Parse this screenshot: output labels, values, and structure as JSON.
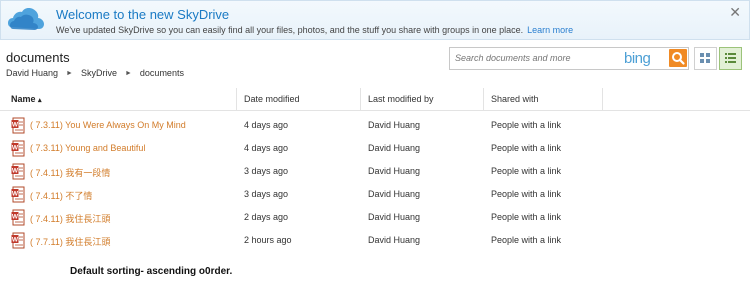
{
  "banner": {
    "title": "Welcome to the new SkyDrive",
    "message": "We've updated SkyDrive so you can easily find all your files, photos, and the stuff you share with groups in one place.",
    "learn_more": "Learn more",
    "close": "✕"
  },
  "page": {
    "title": "documents"
  },
  "breadcrumb": [
    "David Huang",
    "SkyDrive",
    "documents"
  ],
  "search": {
    "placeholder": "Search documents and more",
    "brand": "bing"
  },
  "table": {
    "columns": {
      "name": "Name",
      "sort_indicator": "▴",
      "date": "Date modified",
      "modified_by": "Last modified by",
      "shared": "Shared with"
    },
    "rows": [
      {
        "name": "( 7.3.11) You Were Always On My Mind",
        "date": "4 days ago",
        "modified_by": "David Huang",
        "shared": "People with a link"
      },
      {
        "name": "( 7.3.11) Young and Beautiful",
        "date": "4 days ago",
        "modified_by": "David Huang",
        "shared": "People with a link"
      },
      {
        "name": "( 7.4.11) 我有一段情",
        "date": "3 days ago",
        "modified_by": "David Huang",
        "shared": "People with a link"
      },
      {
        "name": "( 7.4.11) 不了情",
        "date": "3 days ago",
        "modified_by": "David Huang",
        "shared": "People with a link"
      },
      {
        "name": "( 7.4.11) 我住長江頭",
        "date": "2 days ago",
        "modified_by": "David Huang",
        "shared": "People with a link"
      },
      {
        "name": "( 7.7.11) 我住長江頭",
        "date": "2 hours ago",
        "modified_by": "David Huang",
        "shared": "People with a link"
      }
    ]
  },
  "note": "Default sorting- ascending o0rder.",
  "colors": {
    "accent": "#1a7ac4",
    "file_link": "#d27c2a",
    "bing_button": "#f08a24",
    "active_view": "#e2f0d6"
  },
  "icons": {
    "logo": "skydrive-cloud-icon",
    "file": "document-file-icon",
    "search": "search-icon",
    "thumbnail_view": "thumbnail-view-icon",
    "details_view": "details-view-icon"
  }
}
